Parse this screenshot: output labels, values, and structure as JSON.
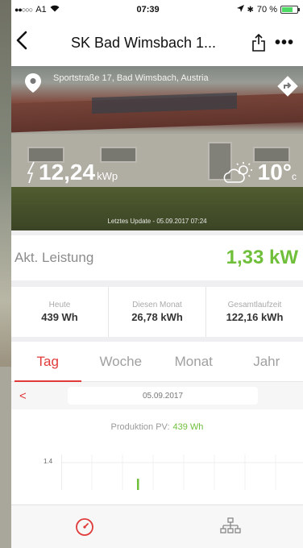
{
  "status_bar": {
    "carrier": "A1",
    "time": "07:39",
    "battery": "70 %"
  },
  "nav": {
    "title": "SK Bad Wimsbach 1..."
  },
  "hero": {
    "address": "Sportstraße 17, Bad Wimsbach, Austria",
    "peak_power_value": "12,24",
    "peak_power_unit": "kWp",
    "temperature": "10°",
    "temperature_unit": "c",
    "last_update": "Letztes Update - 05.09.2017 07:24"
  },
  "current": {
    "label": "Akt. Leistung",
    "value": "1,33 kW"
  },
  "stats": [
    {
      "label": "Heute",
      "value": "439 Wh"
    },
    {
      "label": "Diesen Monat",
      "value": "26,78 kWh"
    },
    {
      "label": "Gesamtlaufzeit",
      "value": "122,16 kWh"
    }
  ],
  "tabs": [
    "Tag",
    "Woche",
    "Monat",
    "Jahr"
  ],
  "active_tab": "Tag",
  "date_picker": {
    "prev": "<",
    "date": "05.09.2017"
  },
  "production": {
    "label": "Produktion PV:",
    "value": "439 Wh"
  },
  "chart": {
    "y_tick": "1.4"
  },
  "colors": {
    "accent": "#e03a3a",
    "positive": "#6fbf3a"
  },
  "tab_bar": {
    "icons": [
      "dashboard-icon",
      "network-icon"
    ]
  }
}
